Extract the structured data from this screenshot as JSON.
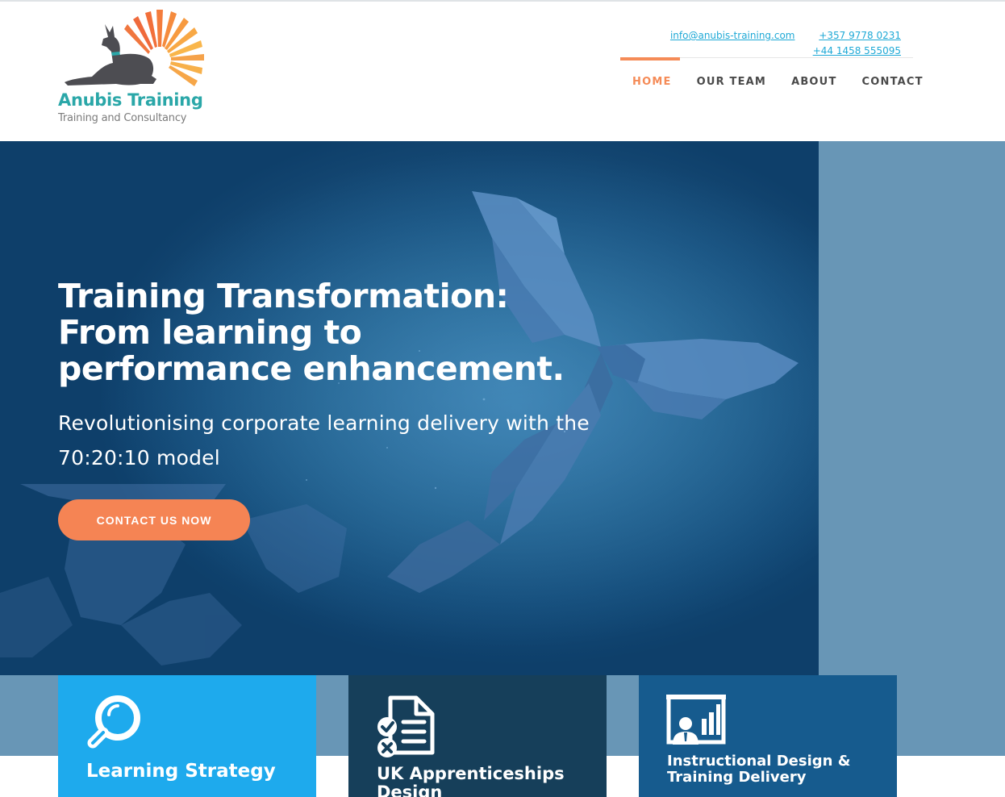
{
  "brand": {
    "name": "Anubis Training",
    "tagline": "Training and Consultancy"
  },
  "contact": {
    "email": "info@anubis-training.com",
    "phone_cy": "+357 9778 0231",
    "phone_uk": "+44 1458 555095"
  },
  "nav": {
    "items": [
      {
        "label": "HOME",
        "active": true
      },
      {
        "label": "OUR TEAM",
        "active": false
      },
      {
        "label": "ABOUT",
        "active": false
      },
      {
        "label": "CONTACT",
        "active": false
      }
    ]
  },
  "hero": {
    "title_line1": "Training Transformation:",
    "title_line2": "From learning to",
    "title_line3": "performance enhancement.",
    "subtitle": "Revolutionising corporate learning delivery with the 70:20:10 model",
    "cta_label": "CONTACT US NOW"
  },
  "cards": [
    {
      "label_line1": "Learning Strategy",
      "label_line2": "",
      "icon": "magnifier-icon"
    },
    {
      "label_line1": "UK Apprenticeships",
      "label_line2": "Design",
      "icon": "checklist-document-icon"
    },
    {
      "label_line1": "Instructional Design &",
      "label_line2": "Training Delivery",
      "icon": "presentation-board-icon"
    }
  ],
  "colors": {
    "accent": "#f58b57",
    "link": "#1fa9d6",
    "hero_bg": "#124a78",
    "side_band": "#6896b6",
    "card1": "#1eaaed",
    "card2": "#163f5a",
    "card3": "#165b8e",
    "logo_teal": "#2aa7a8"
  }
}
